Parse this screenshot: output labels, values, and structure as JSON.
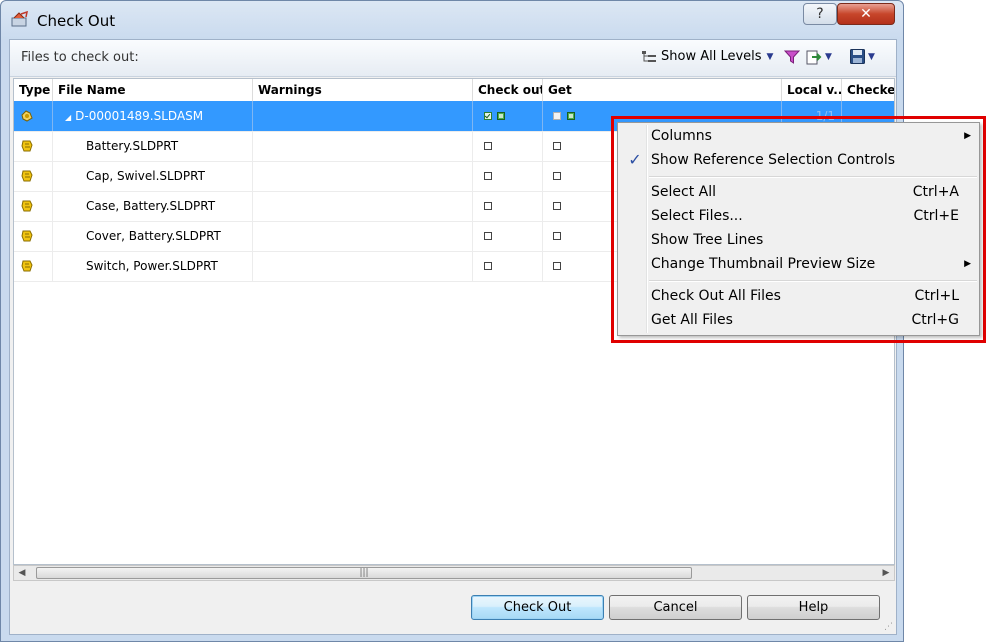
{
  "window": {
    "title": "Check Out",
    "help_label": "?",
    "close_label": "✕"
  },
  "toolbar": {
    "files_label": "Files to check out:",
    "show_levels_label": "Show All Levels"
  },
  "grid": {
    "columns": [
      "Type",
      "File Name",
      "Warnings",
      "Check out",
      "Get",
      "Local v...",
      "Checked"
    ],
    "rows": [
      {
        "name": "D-00001489.SLDASM",
        "local_version": "1/1",
        "selected": true,
        "checkout_checked": true,
        "get_checked": true
      },
      {
        "name": "Battery.SLDPRT",
        "selected": false,
        "checkout_checked": false,
        "get_checked": false
      },
      {
        "name": "Cap, Swivel.SLDPRT",
        "selected": false,
        "checkout_checked": false,
        "get_checked": false
      },
      {
        "name": "Case, Battery.SLDPRT",
        "selected": false,
        "checkout_checked": false,
        "get_checked": false
      },
      {
        "name": "Cover, Battery.SLDPRT",
        "selected": false,
        "checkout_checked": false,
        "get_checked": false
      },
      {
        "name": "Switch, Power.SLDPRT",
        "selected": false,
        "checkout_checked": false,
        "get_checked": false
      }
    ]
  },
  "scrollbar": {
    "left_arrow": "◀",
    "right_arrow": "▶",
    "thumb_grip": "|||"
  },
  "buttons": {
    "check_out": "Check Out",
    "cancel": "Cancel",
    "help": "Help"
  },
  "context_menu": {
    "items": [
      {
        "label": "Columns",
        "shortcut": "",
        "submenu": true,
        "checked": false
      },
      {
        "label": "Show Reference Selection Controls",
        "shortcut": "",
        "submenu": false,
        "checked": true
      },
      {
        "label": "Select All",
        "shortcut": "Ctrl+A",
        "submenu": false,
        "checked": false
      },
      {
        "label": "Select Files...",
        "shortcut": "Ctrl+E",
        "submenu": false,
        "checked": false
      },
      {
        "label": "Show Tree Lines",
        "shortcut": "",
        "submenu": false,
        "checked": false
      },
      {
        "label": "Change Thumbnail Preview Size",
        "shortcut": "",
        "submenu": true,
        "checked": false
      },
      {
        "label": "Check Out All Files",
        "shortcut": "Ctrl+L",
        "submenu": false,
        "checked": false
      },
      {
        "label": "Get All Files",
        "shortcut": "Ctrl+G",
        "submenu": false,
        "checked": false
      }
    ],
    "check_glyph": "✓",
    "submenu_glyph": "▶"
  },
  "colors": {
    "selection": "#3399ff",
    "highlight_outline": "#e00000",
    "part_icon": "#e8b800"
  },
  "icons": {
    "title": "check-out-app-icon",
    "tree": "tree-levels-icon",
    "filter": "funnel-filter-icon",
    "export": "export-icon",
    "save": "floppy-save-icon",
    "assembly": "assembly-icon",
    "part": "part-icon"
  }
}
